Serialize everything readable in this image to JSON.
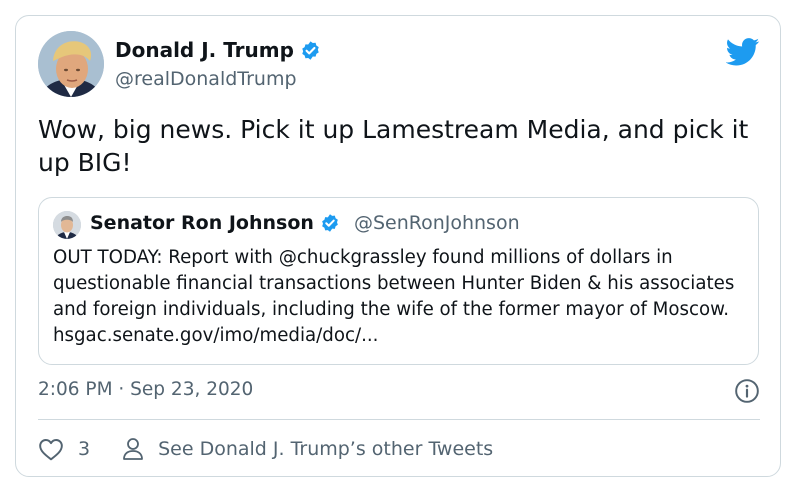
{
  "author": {
    "name": "Donald J. Trump",
    "handle": "@realDonaldTrump"
  },
  "tweet": {
    "text": "Wow, big news. Pick it up Lamestream Media, and pick it up BIG!",
    "timestamp": "2:06 PM · Sep 23, 2020"
  },
  "quoted_tweet": {
    "name": "Senator Ron Johnson",
    "handle": "@SenRonJohnson",
    "text": "OUT TODAY: Report with @chuckgrassley found millions of dollars in questionable financial transactions between Hunter Biden & his associates and foreign individuals, including the wife of the former mayor of Moscow. hsgac.senate.gov/imo/media/doc/..."
  },
  "actions": {
    "like_count": "3",
    "other_tweets_label": "See Donald J. Trump’s other Tweets"
  },
  "icons": {
    "verified": "verified-badge-icon",
    "brand": "twitter-bird-icon",
    "info": "info-icon",
    "like": "heart-icon",
    "profile": "person-icon"
  },
  "colors": {
    "accent": "#1d9bf0",
    "text": "#0f1419",
    "muted": "#536471",
    "border": "#cfd9de"
  }
}
